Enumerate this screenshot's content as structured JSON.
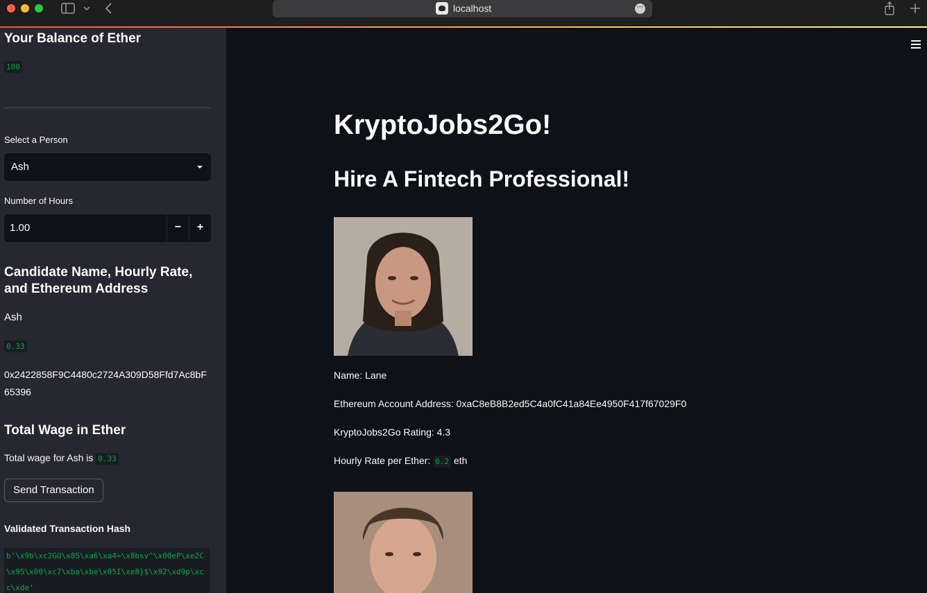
{
  "browser": {
    "url": "localhost"
  },
  "sidebar": {
    "balance_heading": "Your Balance of Ether",
    "balance_value": "100",
    "select_person_label": "Select a Person",
    "select_person_value": "Ash",
    "hours_label": "Number of Hours",
    "hours_value": "1.00",
    "hours_decrement": "−",
    "hours_increment": "+",
    "candidate_heading": "Candidate Name, Hourly Rate, and Ethereum Address",
    "candidate_name": "Ash",
    "candidate_rate": "0.33",
    "candidate_address": "0x2422858F9C4480c2724A309D58Ffd7Ac8bF65396",
    "wage_heading": "Total Wage in Ether",
    "wage_text": "Total wage for Ash is",
    "wage_value": "0.33",
    "send_button": "Send Transaction",
    "hash_heading": "Validated Transaction Hash",
    "hash_value": "b'\\x9b\\xc2GO\\x85\\xa6\\xa4=\\x8bsv^\\x00eP\\xe2C\\x95\\x00\\xc7\\xba\\xbe\\x05I\\xe8}$\\x92\\xd9p\\xcc\\xde'"
  },
  "main": {
    "title": "KryptoJobs2Go!",
    "subtitle": "Hire A Fintech Professional!",
    "candidates": [
      {
        "name": "Name: Lane",
        "address": "Ethereum Account Address: 0xaC8eB8B2ed5C4a0fC41a84Ee4950F417f67029F0",
        "rating": "KryptoJobs2Go Rating: 4.3",
        "rate_label": "Hourly Rate per Ether:",
        "rate_value": "0.2",
        "rate_unit": "eth"
      }
    ]
  }
}
